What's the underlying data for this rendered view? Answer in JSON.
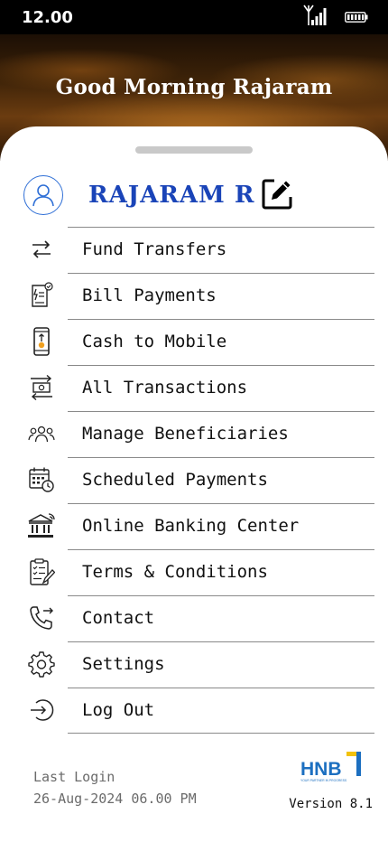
{
  "status_bar": {
    "time": "12.00",
    "icons": [
      "signal-icon",
      "battery-icon"
    ]
  },
  "hero": {
    "greeting": "Good Morning Rajaram"
  },
  "profile": {
    "name": "RAJARAM R"
  },
  "menu": {
    "items": [
      {
        "label": "Fund Transfers",
        "icon": "fund-transfer-icon"
      },
      {
        "label": "Bill Payments",
        "icon": "bill-payments-icon"
      },
      {
        "label": "Cash to Mobile",
        "icon": "cash-to-mobile-icon"
      },
      {
        "label": "All Transactions",
        "icon": "transactions-icon"
      },
      {
        "label": "Manage Beneficiaries",
        "icon": "beneficiaries-icon"
      },
      {
        "label": "Scheduled Payments",
        "icon": "scheduled-payments-icon"
      },
      {
        "label": "Online Banking Center",
        "icon": "bank-icon"
      },
      {
        "label": "Terms & Conditions",
        "icon": "terms-icon"
      },
      {
        "label": "Contact",
        "icon": "phone-icon"
      },
      {
        "label": "Settings",
        "icon": "gear-icon"
      },
      {
        "label": "Log Out",
        "icon": "logout-icon"
      }
    ]
  },
  "footer": {
    "last_login_label": "Last Login",
    "last_login_value": "26-Aug-2024 06.00 PM",
    "brand": "HNB",
    "brand_tagline": "YOUR PARTNER IN PROGRESS",
    "version": "Version 8.1"
  },
  "colors": {
    "accent": "#1a44b8",
    "avatar_border": "#2f6fd6",
    "brand_blue": "#1c6fc0",
    "brand_yellow": "#f2c20c"
  }
}
